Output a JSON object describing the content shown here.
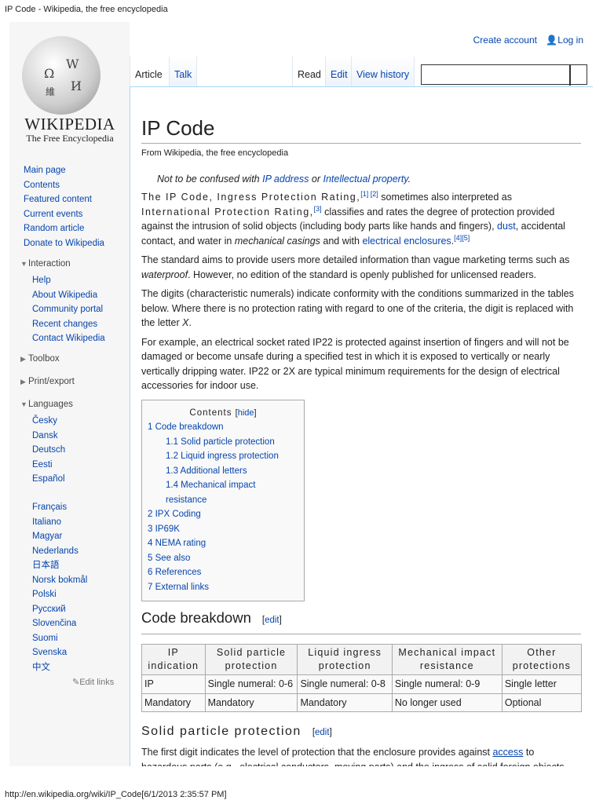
{
  "window_title": "IP Code - Wikipedia, the free encyclopedia",
  "footer_url": "http://en.wikipedia.org/wiki/IP_Code[6/1/2013 2:35:57 PM]",
  "logo": {
    "wordmark": "WIKIPEDIA",
    "tagline": "The Free Encyclopedia"
  },
  "personal": {
    "create_account": "Create account",
    "login": "Log in"
  },
  "tabs": {
    "article": "Article",
    "talk": "Talk",
    "read": "Read",
    "edit": "Edit",
    "history": "View history"
  },
  "search": {
    "value": ""
  },
  "sidebar": {
    "main": [
      "Main page",
      "Contents",
      "Featured content",
      "Current events",
      "Random article",
      "Donate to Wikipedia"
    ],
    "interaction_label": "Interaction",
    "interaction": [
      "Help",
      "About Wikipedia",
      "Community portal",
      "Recent changes",
      "Contact Wikipedia"
    ],
    "toolbox_label": "Toolbox",
    "print_label": "Print/export",
    "languages_label": "Languages",
    "languages_a": [
      "Česky",
      "Dansk",
      "Deutsch",
      "Eesti",
      "Español"
    ],
    "languages_b": [
      "Français",
      "Italiano",
      "Magyar",
      "Nederlands",
      "日本語",
      "Norsk bokmål",
      "Polski",
      "Русский",
      "Slovenčina",
      "Suomi",
      "Svenska",
      "中文"
    ],
    "edit_links": "Edit links"
  },
  "article": {
    "title": "IP Code",
    "from": "From Wikipedia, the free encyclopedia",
    "hatnote": {
      "pre": "Not to be confused with ",
      "link1": "IP address",
      "mid": " or ",
      "link2": "Intellectual property",
      "post": "."
    },
    "p1": {
      "a": "The IP Code, Ingress Protection Rating,",
      "r1": "[1]",
      "r2": "[2]",
      "b": " sometimes also interpreted as ",
      "c": "International Protection Rating,",
      "r3": "[3]",
      "d": " classifies and rates the degree of protection provided against the intrusion of solid objects (including body parts like hands and fingers), ",
      "dust": "dust",
      "e": ", accidental contact, and water in ",
      "f": "mechanical casings",
      "g": " and with ",
      "link": "electrical enclosures",
      "h": ".",
      "r4": "[4]",
      "r5": "[5]"
    },
    "p2": {
      "a": "The standard aims to provide users more detailed information than vague marketing terms such as ",
      "b": "waterproof",
      "c": ". However, no edition of the standard is openly published for unlicensed readers."
    },
    "p3": {
      "a": "The digits (characteristic numerals) indicate conformity with the conditions summarized in the tables below. Where there is no protection rating with regard to one of the criteria, the digit is replaced with the letter ",
      "b": "X",
      "c": "."
    },
    "p4": "For example, an electrical socket rated IP22 is protected against insertion of fingers and will not be damaged or become unsafe during a specified test in which it is exposed to vertically or nearly vertically dripping water. IP22 or 2X are typical minimum requirements for the design of electrical accessories for indoor use.",
    "toc": {
      "title": "Contents",
      "hide": "hide",
      "items": [
        {
          "label": "1 Code breakdown",
          "level": 1
        },
        {
          "label": "1.1 Solid particle protection",
          "level": 2
        },
        {
          "label": "1.2 Liquid ingress protection",
          "level": 2
        },
        {
          "label": "1.3 Additional letters",
          "level": 2
        },
        {
          "label": "1.4 Mechanical impact resistance",
          "level": 2
        },
        {
          "label": "2 IPX Coding",
          "level": 1
        },
        {
          "label": "3 IP69K",
          "level": 1
        },
        {
          "label": "4 NEMA rating",
          "level": 1
        },
        {
          "label": "5 See also",
          "level": 1
        },
        {
          "label": "6 References",
          "level": 1
        },
        {
          "label": "7 External links",
          "level": 1
        }
      ]
    },
    "h_code": "Code breakdown",
    "edit_label": "edit",
    "table": {
      "headers": [
        "IP indication",
        "Solid particle protection",
        "Liquid ingress protection",
        "Mechanical impact resistance",
        "Other protections"
      ],
      "rows": [
        [
          "IP",
          "Single numeral: 0-6",
          "Single numeral: 0-8",
          "Single numeral: 0-9",
          "Single letter"
        ],
        [
          "Mandatory",
          "Mandatory",
          "Mandatory",
          "No longer used",
          "Optional"
        ]
      ]
    },
    "h_solid": "Solid particle protection",
    "p5": {
      "a": "The first digit indicates the level of protection that the enclosure provides against ",
      "link": "access",
      "b": " to hazardous parts (e.g., electrical conductors, moving parts) and the ingress of solid foreign objects."
    }
  }
}
